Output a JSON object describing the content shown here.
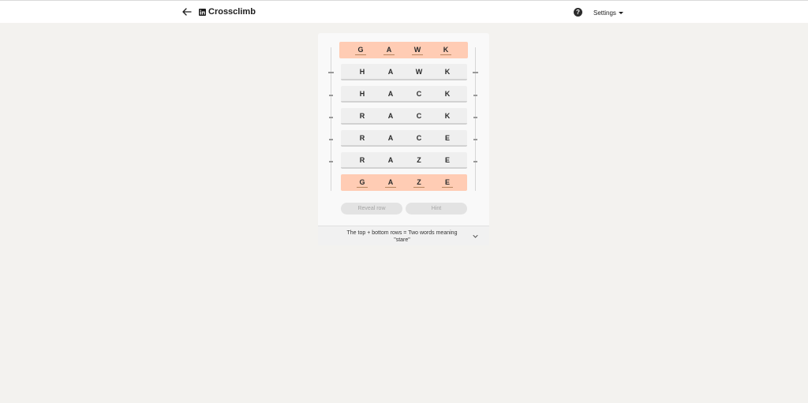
{
  "header": {
    "title": "Crossclimb",
    "help_symbol": "?",
    "settings_label": "Settings"
  },
  "puzzle": {
    "rows": [
      {
        "letters": [
          "G",
          "A",
          "W",
          "K"
        ],
        "locked": true
      },
      {
        "letters": [
          "H",
          "A",
          "W",
          "K"
        ],
        "locked": false
      },
      {
        "letters": [
          "H",
          "A",
          "C",
          "K"
        ],
        "locked": false
      },
      {
        "letters": [
          "R",
          "A",
          "C",
          "K"
        ],
        "locked": false
      },
      {
        "letters": [
          "R",
          "A",
          "C",
          "E"
        ],
        "locked": false
      },
      {
        "letters": [
          "R",
          "A",
          "Z",
          "E"
        ],
        "locked": false
      },
      {
        "letters": [
          "G",
          "A",
          "Z",
          "E"
        ],
        "locked": true
      }
    ]
  },
  "controls": {
    "reveal_label": "Reveal row",
    "hint_label": "Hint"
  },
  "clue": {
    "text": "The top + bottom rows = Two words meaning \"stare\""
  },
  "icons": {
    "back": "arrow-left-icon",
    "logo": "linkedin-logo-icon",
    "help": "question-circle-icon",
    "settings_caret": "caret-down-icon",
    "clue_expand": "chevron-down-icon",
    "drag_handle": "drag-handle-icon"
  },
  "colors": {
    "background": "#f3f2ef",
    "locked_row": "#ffccb4",
    "row": "#efefef",
    "button_disabled": "#e3e3e3"
  }
}
